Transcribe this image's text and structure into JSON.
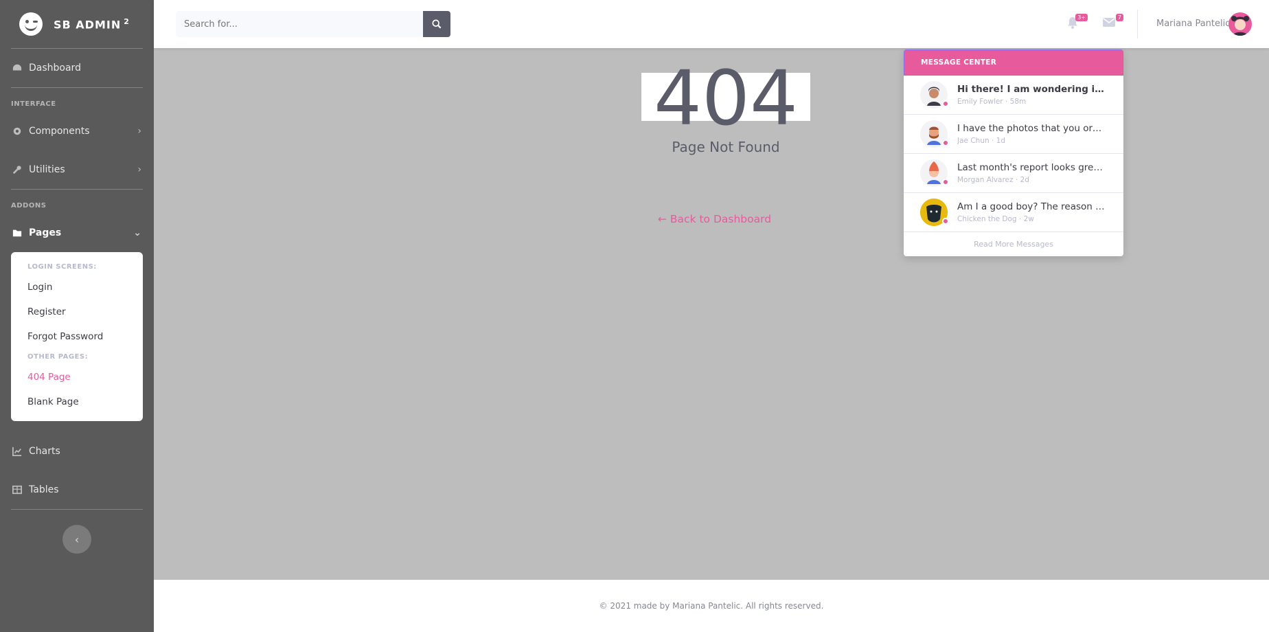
{
  "brand": {
    "name": "SB ADMIN",
    "sup": "2"
  },
  "sidebar": {
    "dashboard": "Dashboard",
    "head_interface": "INTERFACE",
    "components": "Components",
    "utilities": "Utilities",
    "head_addons": "ADDONS",
    "pages": "Pages",
    "pages_menu": {
      "head_login": "LOGIN SCREENS:",
      "login": "Login",
      "register": "Register",
      "forgot": "Forgot Password",
      "head_other": "OTHER PAGES:",
      "page404": "404 Page",
      "blank": "Blank Page"
    },
    "charts": "Charts",
    "tables": "Tables"
  },
  "topbar": {
    "search_placeholder": "Search for...",
    "alerts_badge": "3+",
    "messages_badge": "7",
    "user_name": "Mariana Pantelic"
  },
  "error": {
    "code": "404",
    "title": "Page Not Found",
    "back": "← Back to Dashboard"
  },
  "messages": {
    "header": "MESSAGE CENTER",
    "items": [
      {
        "text": "Hi there! I am wondering if you ...",
        "meta": "Emily Fowler · 58m"
      },
      {
        "text": "I have the photos that you ordere...",
        "meta": "Jae Chun · 1d"
      },
      {
        "text": "Last month's report looks great, I ...",
        "meta": "Morgan Alvarez · 2d"
      },
      {
        "text": "Am I a good boy? The reason I as...",
        "meta": "Chicken the Dog · 2w"
      }
    ],
    "footer": "Read More Messages"
  },
  "footer": {
    "text": "© 2021 made by Mariana Pantelic. All rights reserved."
  },
  "colors": {
    "accent": "#e75a9c",
    "sidebar": "#5a5a5a",
    "overlay": "#bdbdbd"
  }
}
